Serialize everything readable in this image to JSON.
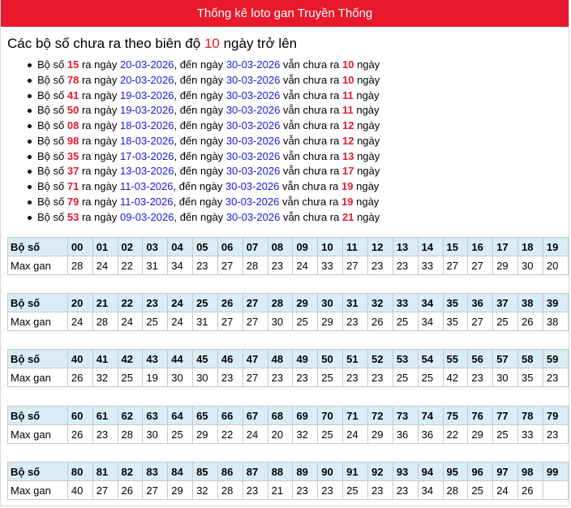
{
  "title": "Thống kê loto gan Truyền Thống",
  "subtitle": {
    "prefix": "Các bộ số chưa ra theo biên độ",
    "amplitude": "10",
    "suffix": "ngày trở lên"
  },
  "labels": {
    "bo_so": "Bộ số",
    "ra_ngay": "ra ngày",
    "den_ngay": ", đến ngày",
    "van_chua_ra": "vẫn chưa ra",
    "ngay": "ngày",
    "max_gan": "Max gan"
  },
  "items": [
    {
      "number": "15",
      "from": "20-03-2026",
      "to": "30-03-2026",
      "days": "10"
    },
    {
      "number": "78",
      "from": "20-03-2026",
      "to": "30-03-2026",
      "days": "10"
    },
    {
      "number": "41",
      "from": "19-03-2026",
      "to": "30-03-2026",
      "days": "11"
    },
    {
      "number": "50",
      "from": "19-03-2026",
      "to": "30-03-2026",
      "days": "11"
    },
    {
      "number": "08",
      "from": "18-03-2026",
      "to": "30-03-2026",
      "days": "12"
    },
    {
      "number": "98",
      "from": "18-03-2026",
      "to": "30-03-2026",
      "days": "12"
    },
    {
      "number": "35",
      "from": "17-03-2026",
      "to": "30-03-2026",
      "days": "13"
    },
    {
      "number": "37",
      "from": "13-03-2026",
      "to": "30-03-2026",
      "days": "17"
    },
    {
      "number": "71",
      "from": "11-03-2026",
      "to": "30-03-2026",
      "days": "19"
    },
    {
      "number": "79",
      "from": "11-03-2026",
      "to": "30-03-2026",
      "days": "19"
    },
    {
      "number": "53",
      "from": "09-03-2026",
      "to": "30-03-2026",
      "days": "21"
    }
  ],
  "tables": [
    {
      "numbers": [
        "00",
        "01",
        "02",
        "03",
        "04",
        "05",
        "06",
        "07",
        "08",
        "09",
        "10",
        "11",
        "12",
        "13",
        "14",
        "15",
        "16",
        "17",
        "18",
        "19"
      ],
      "max_gan": [
        "28",
        "24",
        "22",
        "31",
        "34",
        "23",
        "27",
        "28",
        "23",
        "24",
        "33",
        "27",
        "23",
        "23",
        "33",
        "27",
        "27",
        "29",
        "30",
        "20"
      ]
    },
    {
      "numbers": [
        "20",
        "21",
        "22",
        "23",
        "24",
        "25",
        "26",
        "27",
        "28",
        "29",
        "30",
        "31",
        "32",
        "33",
        "34",
        "35",
        "36",
        "37",
        "38",
        "39"
      ],
      "max_gan": [
        "24",
        "28",
        "24",
        "25",
        "24",
        "31",
        "27",
        "27",
        "30",
        "25",
        "29",
        "23",
        "26",
        "25",
        "34",
        "35",
        "27",
        "25",
        "26",
        "38"
      ]
    },
    {
      "numbers": [
        "40",
        "41",
        "42",
        "43",
        "44",
        "45",
        "46",
        "47",
        "48",
        "49",
        "50",
        "51",
        "52",
        "53",
        "54",
        "55",
        "56",
        "57",
        "58",
        "59"
      ],
      "max_gan": [
        "26",
        "32",
        "25",
        "19",
        "30",
        "30",
        "23",
        "27",
        "23",
        "23",
        "25",
        "23",
        "23",
        "25",
        "25",
        "42",
        "23",
        "30",
        "35",
        "23"
      ]
    },
    {
      "numbers": [
        "60",
        "61",
        "62",
        "63",
        "64",
        "65",
        "66",
        "67",
        "68",
        "69",
        "70",
        "71",
        "72",
        "73",
        "74",
        "75",
        "76",
        "77",
        "78",
        "79"
      ],
      "max_gan": [
        "26",
        "23",
        "28",
        "30",
        "25",
        "29",
        "22",
        "24",
        "20",
        "32",
        "25",
        "24",
        "29",
        "36",
        "36",
        "22",
        "29",
        "25",
        "33",
        "23"
      ]
    },
    {
      "numbers": [
        "80",
        "81",
        "82",
        "83",
        "84",
        "85",
        "86",
        "87",
        "88",
        "89",
        "90",
        "91",
        "92",
        "93",
        "94",
        "95",
        "96",
        "97",
        "98",
        "99"
      ],
      "max_gan": [
        "40",
        "27",
        "26",
        "27",
        "29",
        "32",
        "28",
        "23",
        "21",
        "23",
        "23",
        "25",
        "23",
        "23",
        "34",
        "28",
        "25",
        "24",
        "26"
      ]
    }
  ],
  "colors": {
    "brand_red": "#e8192c",
    "date_blue": "#1a1ad6",
    "table_header_bg": "#d9edf7"
  }
}
